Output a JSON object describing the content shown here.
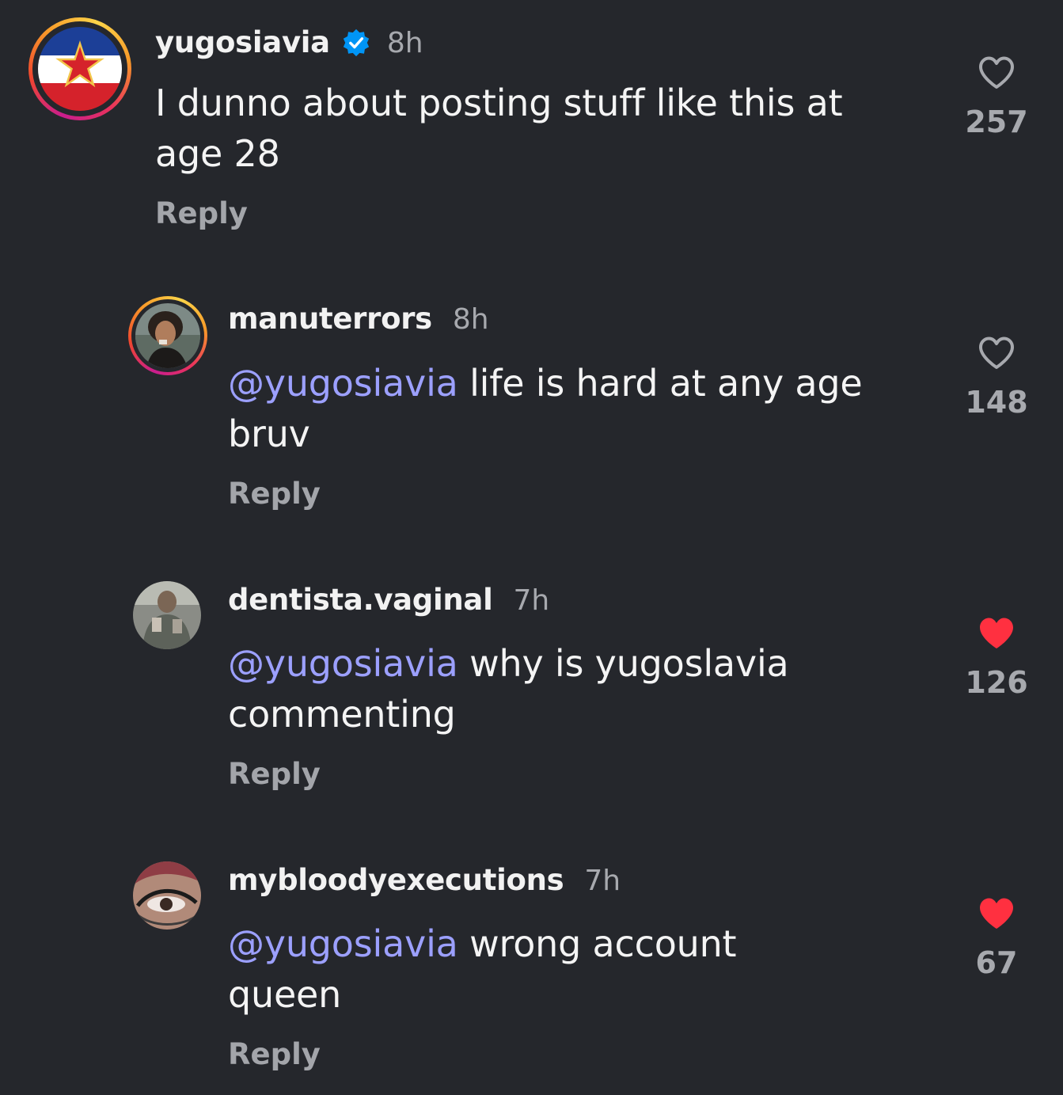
{
  "comments": [
    {
      "username": "yugosiavia",
      "verified": true,
      "time": "8h",
      "mention": "",
      "text_line1": "I dunno about posting stuff like this at",
      "text_line2": "age 28",
      "reply_label": "Reply",
      "likes": "257",
      "liked": false,
      "avatar": "yugoslav-flag-avatar"
    },
    {
      "username": "manuterrors",
      "verified": false,
      "time": "8h",
      "mention": "@yugosiavia",
      "text_line1": " life is hard at any age",
      "text_line2": "bruv",
      "reply_label": "Reply",
      "likes": "148",
      "liked": false,
      "avatar": "person-photo-avatar"
    },
    {
      "username": "dentista.vaginal",
      "verified": false,
      "time": "7h",
      "mention": "@yugosiavia",
      "text_line1": " why is yugoslavia",
      "text_line2": "commenting",
      "reply_label": "Reply",
      "likes": "126",
      "liked": true,
      "avatar": "person-photo-avatar"
    },
    {
      "username": "mybloodyexecutions",
      "verified": false,
      "time": "7h",
      "mention": "@yugosiavia",
      "text_line1": " wrong account",
      "text_line2": "queen",
      "reply_label": "Reply",
      "likes": "67",
      "liked": true,
      "avatar": "eye-closeup-avatar"
    }
  ],
  "colors": {
    "background": "#25272c",
    "mention": "#9ca0ff",
    "liked_heart": "#ff3040",
    "muted_text": "#a7a9ae",
    "verified_badge": "#0095f6"
  }
}
